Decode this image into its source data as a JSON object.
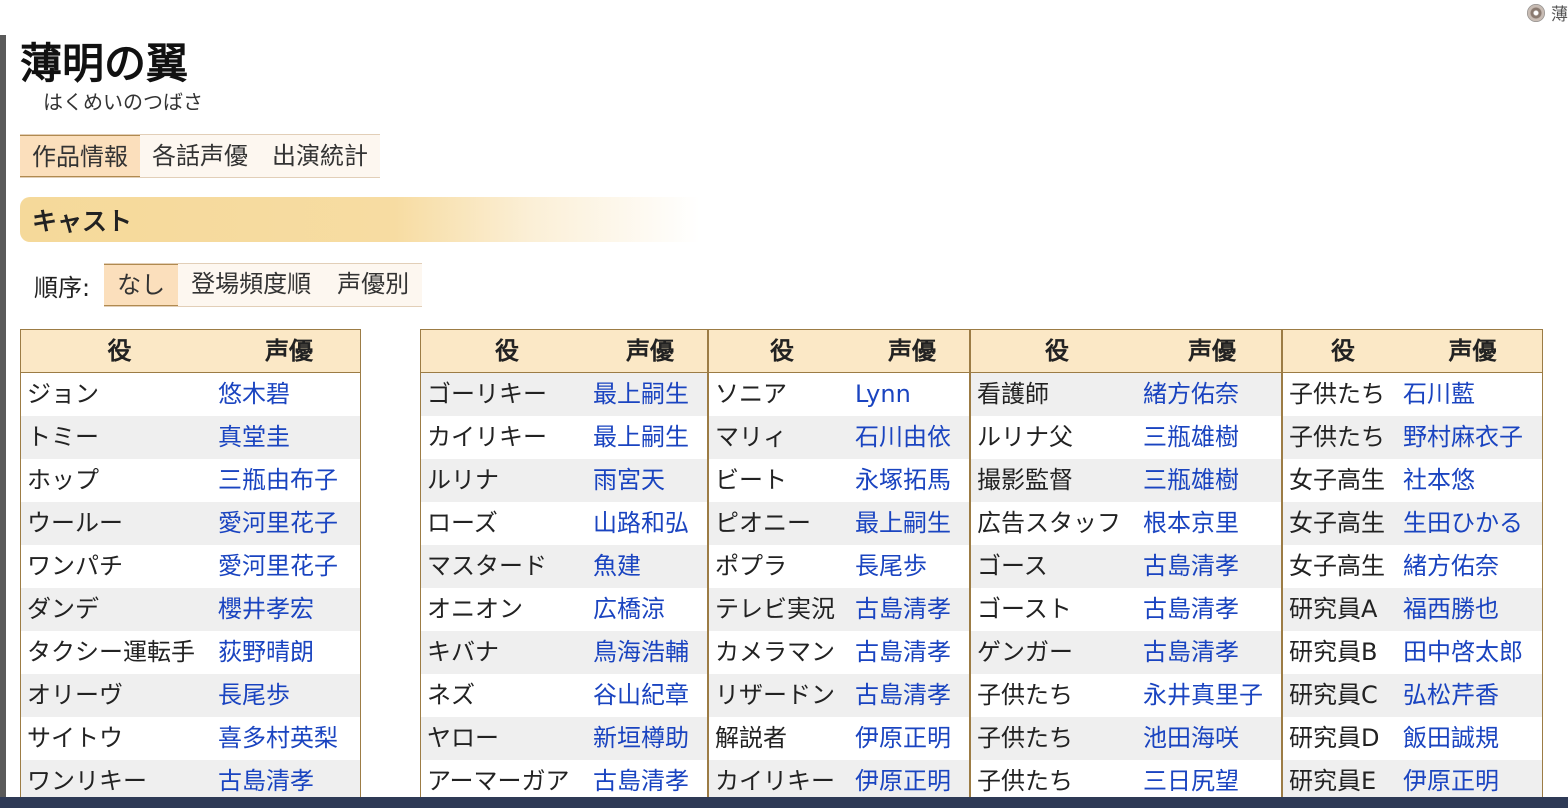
{
  "top_link": "薄",
  "title": "薄明の翼",
  "reading": "はくめいのつばさ",
  "tabs": [
    "作品情報",
    "各話声優",
    "出演統計"
  ],
  "section": "キャスト",
  "order": {
    "label": "順序:",
    "options": [
      "なし",
      "登場頻度順",
      "声優別"
    ]
  },
  "headers": {
    "role": "役",
    "voice": "声優"
  },
  "columns": [
    [
      [
        "ジョン",
        "悠木碧"
      ],
      [
        "トミー",
        "真堂圭"
      ],
      [
        "ホップ",
        "三瓶由布子"
      ],
      [
        "ウールー",
        "愛河里花子"
      ],
      [
        "ワンパチ",
        "愛河里花子"
      ],
      [
        "ダンデ",
        "櫻井孝宏"
      ],
      [
        "タクシー運転手",
        "荻野晴朗"
      ],
      [
        "オリーヴ",
        "長尾歩"
      ],
      [
        "サイトウ",
        "喜多村英梨"
      ],
      [
        "ワンリキー",
        "古島清孝"
      ]
    ],
    [
      [
        "ゴーリキー",
        "最上嗣生"
      ],
      [
        "カイリキー",
        "最上嗣生"
      ],
      [
        "ルリナ",
        "雨宮天"
      ],
      [
        "ローズ",
        "山路和弘"
      ],
      [
        "マスタード",
        "魚建"
      ],
      [
        "オニオン",
        "広橋涼"
      ],
      [
        "キバナ",
        "鳥海浩輔"
      ],
      [
        "ネズ",
        "谷山紀章"
      ],
      [
        "ヤロー",
        "新垣樽助"
      ],
      [
        "アーマーガア",
        "古島清孝"
      ]
    ],
    [
      [
        "ソニア",
        "Lynn"
      ],
      [
        "マリィ",
        "石川由依"
      ],
      [
        "ビート",
        "永塚拓馬"
      ],
      [
        "ピオニー",
        "最上嗣生"
      ],
      [
        "ポプラ",
        "長尾歩"
      ],
      [
        "テレビ実況",
        "古島清孝"
      ],
      [
        "カメラマン",
        "古島清孝"
      ],
      [
        "リザードン",
        "古島清孝"
      ],
      [
        "解説者",
        "伊原正明"
      ],
      [
        "カイリキー",
        "伊原正明"
      ]
    ],
    [
      [
        "看護師",
        "緒方佑奈"
      ],
      [
        "ルリナ父",
        "三瓶雄樹"
      ],
      [
        "撮影監督",
        "三瓶雄樹"
      ],
      [
        "広告スタッフ",
        "根本京里"
      ],
      [
        "ゴース",
        "古島清孝"
      ],
      [
        "ゴースト",
        "古島清孝"
      ],
      [
        "ゲンガー",
        "古島清孝"
      ],
      [
        "子供たち",
        "永井真里子"
      ],
      [
        "子供たち",
        "池田海咲"
      ],
      [
        "子供たち",
        "三日尻望"
      ]
    ],
    [
      [
        "子供たち",
        "石川藍"
      ],
      [
        "子供たち",
        "野村麻衣子"
      ],
      [
        "女子高生",
        "社本悠"
      ],
      [
        "女子高生",
        "生田ひかる"
      ],
      [
        "女子高生",
        "緒方佑奈"
      ],
      [
        "研究員A",
        "福西勝也"
      ],
      [
        "研究員B",
        "田中啓太郎"
      ],
      [
        "研究員C",
        "弘松芹香"
      ],
      [
        "研究員D",
        "飯田誠規"
      ],
      [
        "研究員E",
        "伊原正明"
      ]
    ]
  ]
}
